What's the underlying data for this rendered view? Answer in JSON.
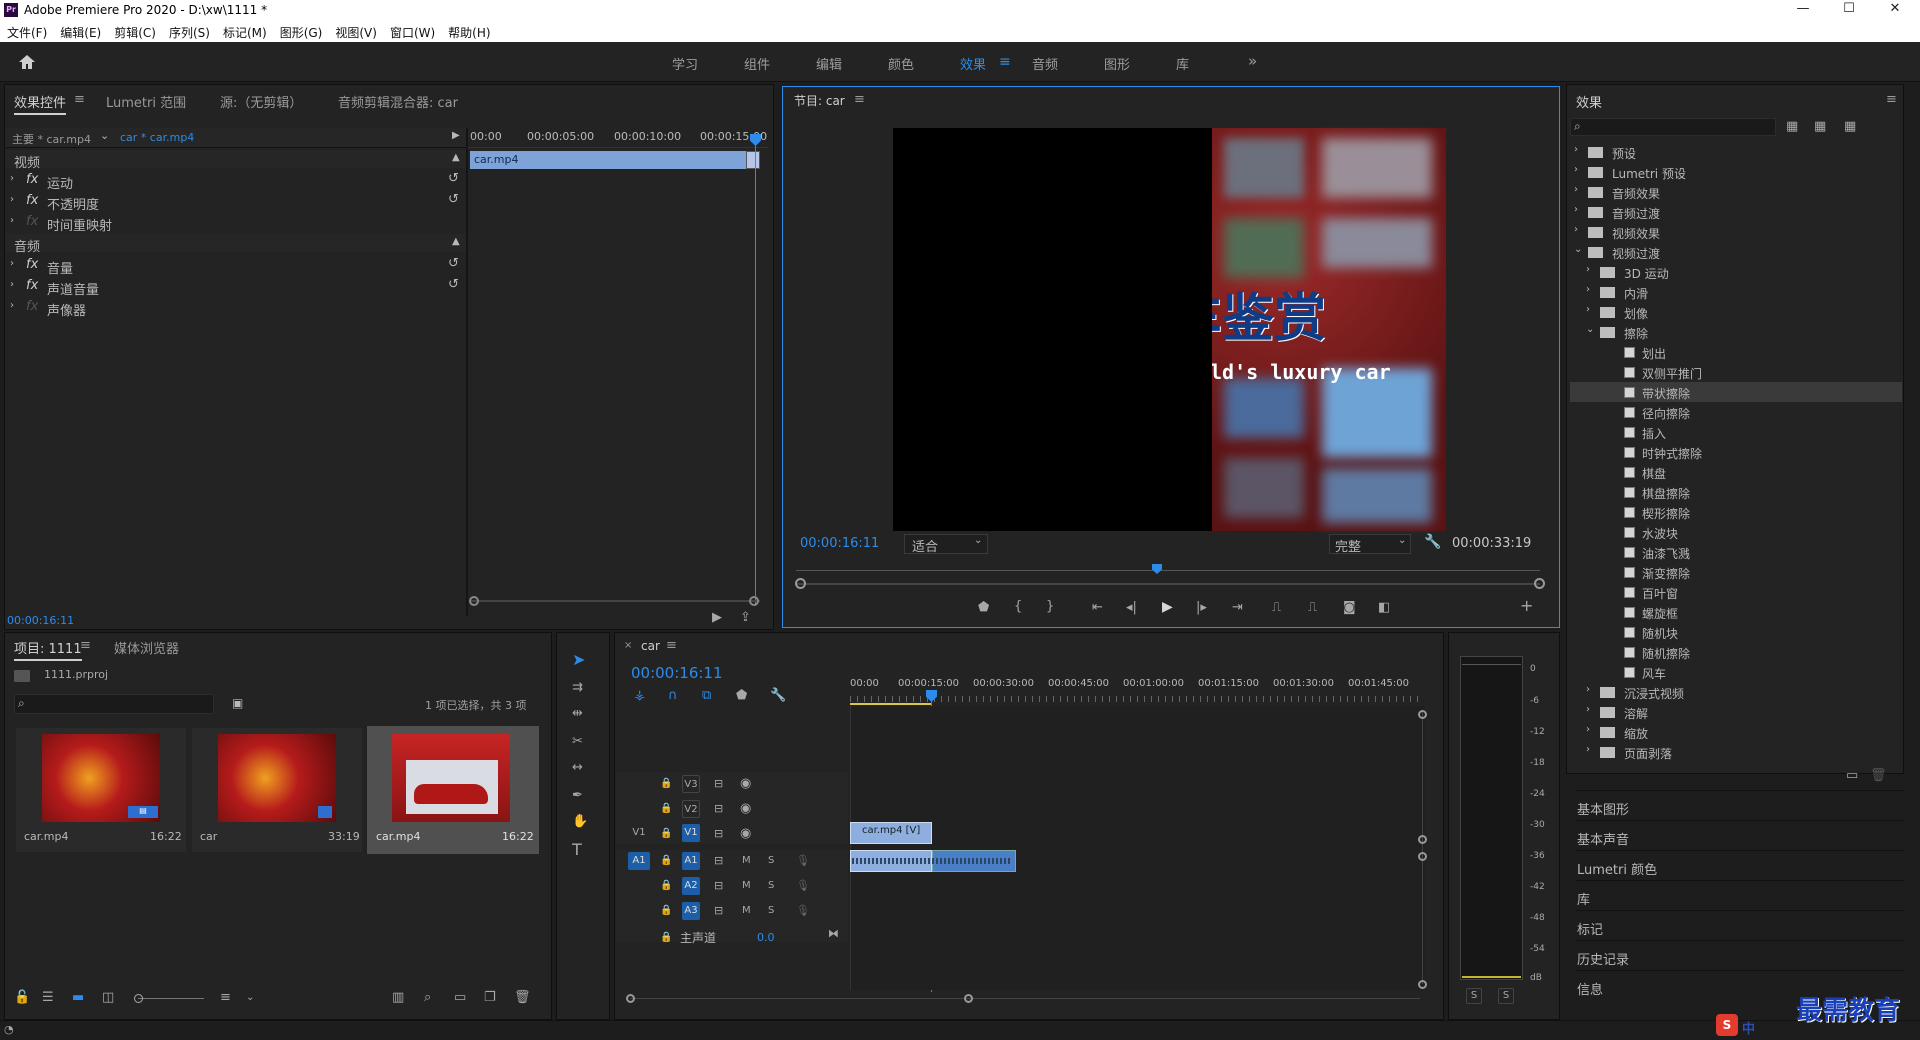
{
  "window": {
    "title": "Adobe Premiere Pro 2020 - D:\\xw\\1111 *",
    "app_icon": "Pr",
    "minimize": "—",
    "maximize": "☐",
    "close": "✕"
  },
  "menu": [
    "文件(F)",
    "编辑(E)",
    "剪辑(C)",
    "序列(S)",
    "标记(M)",
    "图形(G)",
    "视图(V)",
    "窗口(W)",
    "帮助(H)"
  ],
  "workspaces": [
    "学习",
    "组件",
    "编辑",
    "颜色",
    "效果",
    "音频",
    "图形",
    "库"
  ],
  "workspace_active": "效果",
  "workspace_more": "»",
  "effect_controls": {
    "tabs": [
      "效果控件",
      "Lumetri 范围",
      "源:（无剪辑）",
      "音频剪辑混合器: car"
    ],
    "master": "主要 * car.mp4",
    "seq": "car * car.mp4",
    "ruler": [
      "00:00",
      "00:00:05:00",
      "00:00:10:00",
      "00:00:15:00"
    ],
    "clip": "car.mp4",
    "video_hdr": "视频",
    "audio_hdr": "音频",
    "video_props": [
      "运动",
      "不透明度",
      "时间重映射"
    ],
    "audio_props": [
      "音量",
      "声道音量",
      "声像器"
    ],
    "fx": "fx",
    "timecode": "00:00:16:11"
  },
  "program": {
    "title": "节目: car",
    "timecode": "00:00:16:11",
    "fit": "适合",
    "quality": "完整",
    "duration": "00:00:33:19",
    "frame_title": "车鉴赏",
    "frame_sub": "ld's luxury car"
  },
  "project": {
    "tabs": [
      "项目: 1111",
      "媒体浏览器"
    ],
    "file": "1111.prproj",
    "selection": "1 项已选择，共 3 项",
    "items": [
      {
        "name": "car.mp4",
        "dur": "16:22"
      },
      {
        "name": "car",
        "dur": "33:19"
      },
      {
        "name": "car.mp4",
        "dur": "16:22"
      }
    ]
  },
  "timeline": {
    "tab": "car",
    "timecode": "00:00:16:11",
    "ruler": [
      "00:00",
      "00:00:15:00",
      "00:00:30:00",
      "00:00:45:00",
      "00:01:00:00",
      "00:01:15:00",
      "00:01:30:00",
      "00:01:45:00"
    ],
    "video_tracks": [
      "V3",
      "V2",
      "V1"
    ],
    "audio_tracks": [
      "A1",
      "A2",
      "A3"
    ],
    "src_v": "V1",
    "src_a": "A1",
    "master": "主声道",
    "master_val": "0.0",
    "clip": "car.mp4 [V]",
    "m": "M",
    "s": "S"
  },
  "meter": {
    "scale": [
      "0",
      "-6",
      "-12",
      "-18",
      "-24",
      "-30",
      "-36",
      "-42",
      "-48",
      "-54",
      "dB"
    ],
    "solo": [
      "S",
      "S"
    ]
  },
  "effects_panel": {
    "title": "效果",
    "tree": [
      {
        "label": "预设",
        "level": 0,
        "type": "folder",
        "open": false
      },
      {
        "label": "Lumetri 预设",
        "level": 0,
        "type": "folder",
        "open": false
      },
      {
        "label": "音频效果",
        "level": 0,
        "type": "folder",
        "open": false
      },
      {
        "label": "音频过渡",
        "level": 0,
        "type": "folder",
        "open": false
      },
      {
        "label": "视频效果",
        "level": 0,
        "type": "folder",
        "open": false
      },
      {
        "label": "视频过渡",
        "level": 0,
        "type": "folder",
        "open": true
      },
      {
        "label": "3D 运动",
        "level": 1,
        "type": "folder",
        "open": false
      },
      {
        "label": "内滑",
        "level": 1,
        "type": "folder",
        "open": false
      },
      {
        "label": "划像",
        "level": 1,
        "type": "folder",
        "open": false
      },
      {
        "label": "擦除",
        "level": 1,
        "type": "folder",
        "open": true
      },
      {
        "label": "划出",
        "level": 2,
        "type": "fx"
      },
      {
        "label": "双侧平推门",
        "level": 2,
        "type": "fx"
      },
      {
        "label": "带状擦除",
        "level": 2,
        "type": "fx",
        "selected": true
      },
      {
        "label": "径向擦除",
        "level": 2,
        "type": "fx"
      },
      {
        "label": "插入",
        "level": 2,
        "type": "fx"
      },
      {
        "label": "时钟式擦除",
        "level": 2,
        "type": "fx"
      },
      {
        "label": "棋盘",
        "level": 2,
        "type": "fx"
      },
      {
        "label": "棋盘擦除",
        "level": 2,
        "type": "fx"
      },
      {
        "label": "楔形擦除",
        "level": 2,
        "type": "fx"
      },
      {
        "label": "水波块",
        "level": 2,
        "type": "fx"
      },
      {
        "label": "油漆飞溅",
        "level": 2,
        "type": "fx"
      },
      {
        "label": "渐变擦除",
        "level": 2,
        "type": "fx"
      },
      {
        "label": "百叶窗",
        "level": 2,
        "type": "fx"
      },
      {
        "label": "螺旋框",
        "level": 2,
        "type": "fx"
      },
      {
        "label": "随机块",
        "level": 2,
        "type": "fx"
      },
      {
        "label": "随机擦除",
        "level": 2,
        "type": "fx"
      },
      {
        "label": "风车",
        "level": 2,
        "type": "fx"
      },
      {
        "label": "沉浸式视频",
        "level": 1,
        "type": "folder",
        "open": false
      },
      {
        "label": "溶解",
        "level": 1,
        "type": "folder",
        "open": false
      },
      {
        "label": "缩放",
        "level": 1,
        "type": "folder",
        "open": false
      },
      {
        "label": "页面剥落",
        "level": 1,
        "type": "folder",
        "open": false
      }
    ],
    "sections": [
      "基本图形",
      "基本声音",
      "Lumetri 颜色",
      "库",
      "标记",
      "历史记录",
      "信息"
    ]
  },
  "watermark": "最需教育",
  "ime": "中"
}
